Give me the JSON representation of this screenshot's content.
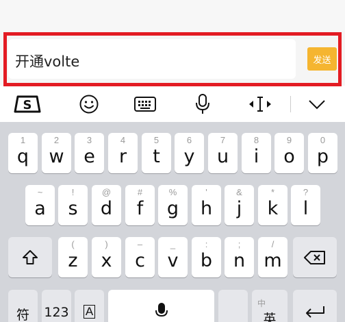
{
  "input": {
    "text": "开通volte",
    "send_label": "发送"
  },
  "toolbar": {
    "icons": [
      "sogou-logo-icon",
      "emoji-icon",
      "keyboard-icon",
      "microphone-icon",
      "cursor-move-icon",
      "chevron-down-icon"
    ],
    "sogou_glyph": "S"
  },
  "keyboard": {
    "row1": [
      {
        "hint": "1",
        "key": "q"
      },
      {
        "hint": "2",
        "key": "w"
      },
      {
        "hint": "3",
        "key": "e"
      },
      {
        "hint": "4",
        "key": "r"
      },
      {
        "hint": "5",
        "key": "t"
      },
      {
        "hint": "6",
        "key": "y"
      },
      {
        "hint": "7",
        "key": "u"
      },
      {
        "hint": "8",
        "key": "i"
      },
      {
        "hint": "9",
        "key": "o"
      },
      {
        "hint": "0",
        "key": "p"
      }
    ],
    "row2": [
      {
        "hint": "~",
        "key": "a"
      },
      {
        "hint": "!",
        "key": "s"
      },
      {
        "hint": "@",
        "key": "d"
      },
      {
        "hint": "#",
        "key": "f"
      },
      {
        "hint": "%",
        "key": "g"
      },
      {
        "hint": "'",
        "key": "h"
      },
      {
        "hint": "&",
        "key": "j"
      },
      {
        "hint": "*",
        "key": "k"
      },
      {
        "hint": "?",
        "key": "l"
      }
    ],
    "row3": [
      {
        "hint": "(",
        "key": "z"
      },
      {
        "hint": ")",
        "key": "x"
      },
      {
        "hint": "–",
        "key": "c"
      },
      {
        "hint": "_",
        "key": "v"
      },
      {
        "hint": ":",
        "key": "b"
      },
      {
        "hint": ";",
        "key": "n"
      },
      {
        "hint": "/",
        "key": "m"
      }
    ],
    "bottom": {
      "symbol_label": "符",
      "num_label": "123",
      "voice_key_label": "A",
      "lang_hint": "中",
      "lang_label": "英"
    }
  }
}
